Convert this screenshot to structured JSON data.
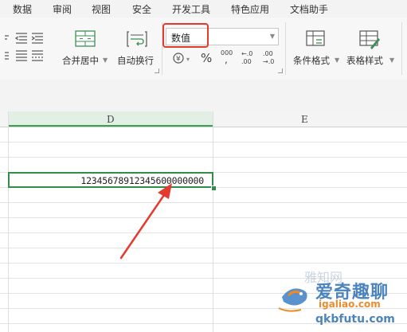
{
  "menu": {
    "items": [
      "数据",
      "审阅",
      "视图",
      "安全",
      "开发工具",
      "特色应用",
      "文档助手"
    ]
  },
  "ribbon": {
    "merge_center": "合并居中",
    "auto_wrap": "自动换行",
    "conditional_format": "条件格式",
    "table_style": "表格样式",
    "percent_symbol": "%",
    "thousands_symbol": "000"
  },
  "number_format": {
    "selected": "数值"
  },
  "sheet": {
    "columns": [
      "D",
      "E"
    ],
    "selected_cell_value": "12345678912345600000000"
  },
  "watermark": {
    "line1": "爱奇趣聊",
    "line2": "igaliao.com",
    "line3": "qkbfutu.com",
    "line4": "雅知网"
  },
  "colors": {
    "highlight_box": "#e63a2e",
    "arrow": "#e63a2e",
    "selection": "#2f8f46",
    "menu_bg": "#f3f3f3"
  }
}
